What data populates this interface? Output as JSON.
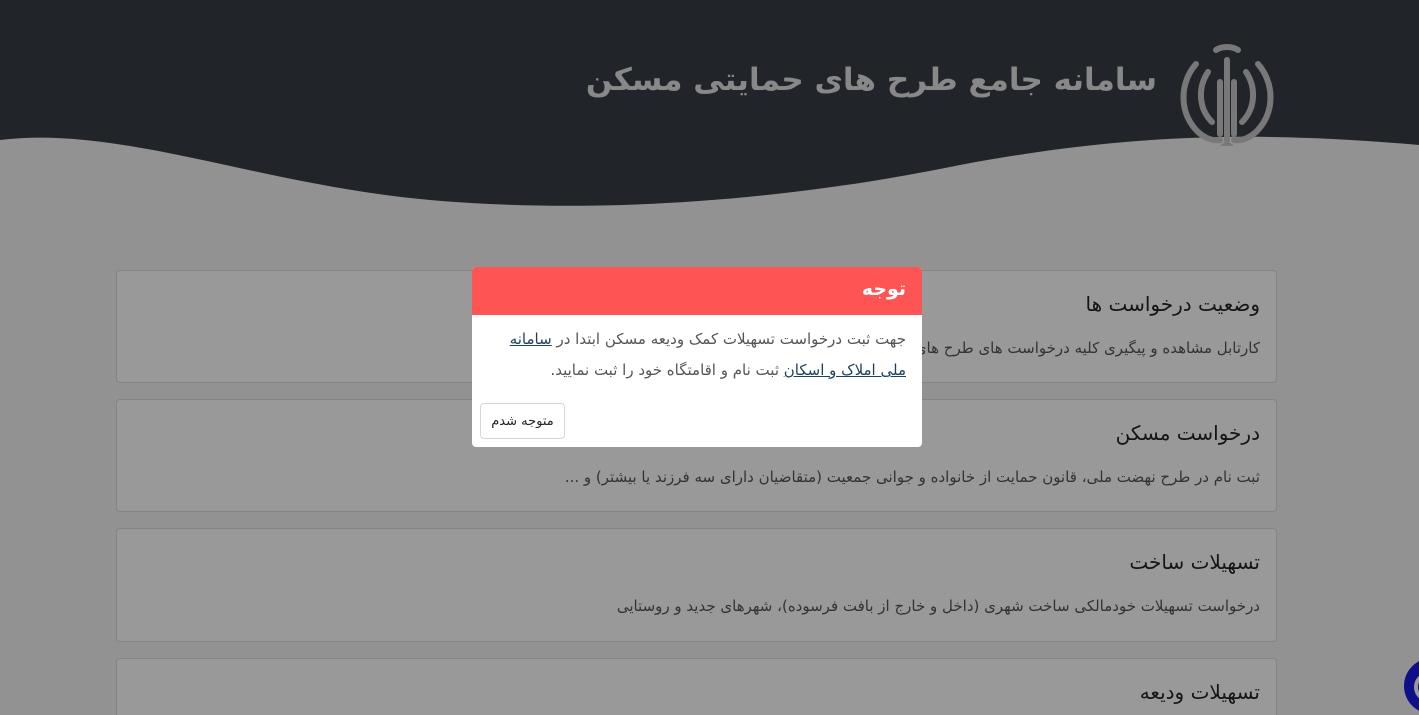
{
  "header": {
    "title": "سامانه جامع طرح های حمایتی مسکن",
    "background_color": "#373f47",
    "title_color": "#e3e3e3"
  },
  "cards": [
    {
      "title": "وضعیت درخواست ها",
      "description": "کارتابل مشاهده و پیگیری کلیه درخواست های طرح های حمایتی"
    },
    {
      "title": "درخواست مسکن",
      "description": "ثبت نام در طرح نهضت ملی، قانون حمایت از خانواده و جوانی جمعیت (متقاضیان دارای سه فرزند یا بیشتر) و ..."
    },
    {
      "title": "تسهیلات ساخت",
      "description": "درخواست تسهیلات خودمالکی ساخت شهری (داخل و خارج از بافت فرسوده)، شهرهای جدید و روستایی"
    },
    {
      "title": "تسهیلات ودیعه",
      "description": ""
    }
  ],
  "modal": {
    "title": "توجه",
    "body_before": "جهت ثبت درخواست تسهیلات کمک ودیعه مسکن ابتدا در ",
    "link_text": "سامانه ملی املاک و اسکان",
    "body_after": " ثبت نام و اقامتگاه خود را ثبت نمایید.",
    "button_label": "متوجه شدم",
    "header_color": "#ff5454"
  },
  "icons": {
    "emblem": "iran-emblem-icon",
    "chat": "chat-icon"
  }
}
